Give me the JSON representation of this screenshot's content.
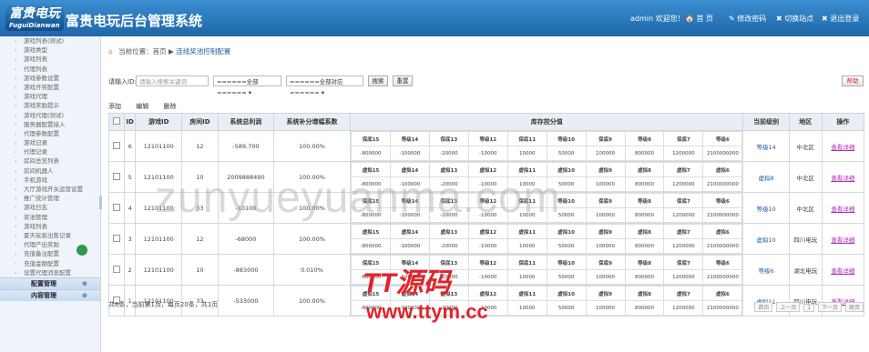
{
  "header": {
    "logo_main": "富贵电玩",
    "logo_sub": "FuguiDianwan",
    "title": "富贵电玩后台管理系统",
    "user": "admin 欢迎您！",
    "home": "首 页",
    "change_password": "修改密码",
    "switch_site": "切换站点",
    "logout": "退出登录"
  },
  "sidebar": {
    "items": [
      "游戏列表(测试)",
      "游戏类型",
      "游戏列表",
      "代理列表",
      "游戏参数设置",
      "游戏开奖配置",
      "游戏代理",
      "游戏奖励提示",
      "游戏代理(测试)",
      "服务器配置接入",
      "代理参数配置",
      "游戏记录",
      "代理记录",
      "房间总览列表",
      "房间机器人",
      "手机游戏",
      "大厅游戏开关运营设置",
      "推广统计管理",
      "游戏日志",
      "奖池管理",
      "游戏列表",
      "夏天玩家出售记录",
      "代理产出奖励",
      "充值备注配置",
      "充值金额配置",
      "设置代理消息配置"
    ],
    "groups": [
      {
        "label": "配置管理",
        "plus": "⊕"
      },
      {
        "label": "内容管理",
        "plus": "⊕"
      }
    ]
  },
  "breadcrumb": {
    "prefix": "当前位置：",
    "home": "首页",
    "sep": "▶",
    "current": "连线奖池控制配置"
  },
  "filters": {
    "label": "请输入ID:",
    "placeholder": "请输入搜索关键词",
    "select1": "======全部====== ▾",
    "select2": "======全部对应====== ▾",
    "search": "搜索",
    "reset": "重置",
    "right_btn": "帮助"
  },
  "tabs": [
    "添加",
    "编辑",
    "删除"
  ],
  "table": {
    "headers": [
      "",
      "ID",
      "游戏ID",
      "房间ID",
      "系统总利润",
      "系统补分增幅系数",
      "",
      "当前级别",
      "地区",
      "操作"
    ],
    "control_header": "库存控分值",
    "rows": [
      {
        "id": "6",
        "game": "12101100",
        "room": "12",
        "profit": "-589,700",
        "rate": "100.00%",
        "ctrl": [
          [
            "保底15",
            "等级14",
            "保底13",
            "等级12",
            "保底11",
            "等级10",
            "保底9",
            "等级8",
            "保底7",
            "等级6"
          ],
          [
            "-800000",
            "-100000",
            "-20000",
            "-10000",
            "10000",
            "50000",
            "100000",
            "800000",
            "1200000",
            "2100000000"
          ]
        ],
        "level": "等级14",
        "region": "中北区",
        "op": "查看详细"
      },
      {
        "id": "5",
        "game": "12101100",
        "room": "10",
        "profit": "2009888490",
        "rate": "100.00%",
        "ctrl": [
          [
            "虚拟15",
            "虚拟14",
            "虚拟13",
            "虚拟12",
            "虚拟11",
            "虚拟10",
            "虚拟9",
            "虚拟8",
            "虚拟7",
            "虚拟6"
          ],
          [
            "-800000",
            "-100000",
            "-20000",
            "-10000",
            "10000",
            "50000",
            "100000",
            "800000",
            "1200000",
            "2100000000"
          ]
        ],
        "level": "虚拟8",
        "region": "中北区",
        "op": "查看详细"
      },
      {
        "id": "4",
        "game": "12101100",
        "room": "33",
        "profit": "-10100",
        "rate": "100.00%",
        "ctrl": [
          [
            "保底15",
            "等级14",
            "保底13",
            "等级12",
            "保底11",
            "等级10",
            "保底9",
            "等级8",
            "保底7",
            "等级6"
          ],
          [
            "-800000",
            "-100000",
            "-20000",
            "-10000",
            "10000",
            "50000",
            "100000",
            "800000",
            "1200000",
            "2100000000"
          ]
        ],
        "level": "等级10",
        "region": "中北区",
        "op": "查看详细"
      },
      {
        "id": "3",
        "game": "12101100",
        "room": "12",
        "profit": "-68000",
        "rate": "100.00%",
        "ctrl": [
          [
            "虚拟15",
            "虚拟14",
            "虚拟13",
            "虚拟12",
            "虚拟11",
            "虚拟10",
            "虚拟9",
            "虚拟8",
            "虚拟7",
            "虚拟6"
          ],
          [
            "-800000",
            "-100000",
            "-20000",
            "-10000",
            "10000",
            "50000",
            "100000",
            "800000",
            "1200000",
            "2100000000"
          ]
        ],
        "level": "虚拟10",
        "region": "四川电玩",
        "op": "查看详细"
      },
      {
        "id": "2",
        "game": "12101100",
        "room": "10",
        "profit": "-883000",
        "rate": "0.010%",
        "ctrl": [
          [
            "保底15",
            "等级14",
            "保底13",
            "等级12",
            "保底11",
            "等级10",
            "保底9",
            "等级8",
            "保底7",
            "等级6"
          ],
          [
            "-800000",
            "-100000",
            "-20000",
            "-10000",
            "10000",
            "50000",
            "100000",
            "800000",
            "1200000",
            "2100000000"
          ]
        ],
        "level": "等级6",
        "region": "湖北电玩",
        "op": "查看详细"
      },
      {
        "id": "1",
        "game": "12101100",
        "room": "33",
        "profit": "-533000",
        "rate": "100.00%",
        "ctrl": [
          [
            "虚拟15",
            "虚拟14",
            "虚拟13",
            "虚拟12",
            "虚拟11",
            "虚拟10",
            "虚拟9",
            "虚拟8",
            "虚拟7",
            "虚拟6"
          ],
          [
            "-800000",
            "-100000",
            "-20000",
            "-10000",
            "10000",
            "50000",
            "100000",
            "800000",
            "1200000",
            "2100000000"
          ]
        ],
        "level": "虚拟11",
        "region": "四川电玩",
        "op": "查看详细"
      }
    ]
  },
  "footer": {
    "summary": "共6条，当前第1页，每页20条，共1页",
    "pager": [
      "首页",
      "上一页",
      "1",
      "下一页",
      "尾页"
    ]
  },
  "watermarks": {
    "wm1": "zunyueyuanma.com",
    "wm2": "TT源码",
    "wm3": "www.ttym.cc"
  }
}
